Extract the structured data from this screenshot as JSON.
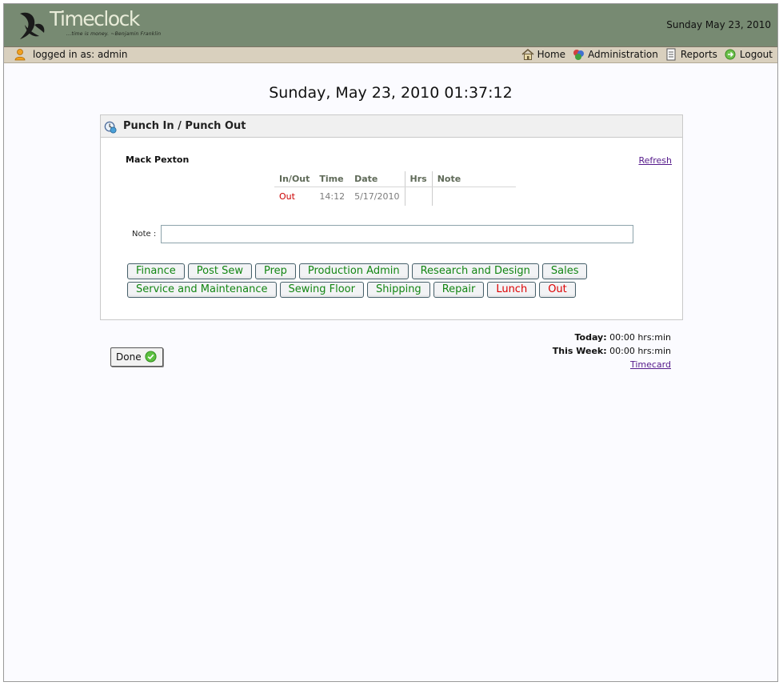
{
  "header": {
    "logo_text": "Timeclock",
    "tagline": "...time is money.   ~Benjamin Franklin",
    "date": "Sunday May 23, 2010"
  },
  "subbar": {
    "logged_in_label": "logged in as: admin",
    "nav": [
      {
        "label": "Home",
        "icon": "home-icon"
      },
      {
        "label": "Administration",
        "icon": "administration-icon"
      },
      {
        "label": "Reports",
        "icon": "reports-icon"
      },
      {
        "label": "Logout",
        "icon": "logout-icon"
      }
    ]
  },
  "clock": "Sunday, May 23, 2010 01:37:12",
  "panel": {
    "title": "Punch In / Punch Out",
    "employee": "Mack Pexton",
    "refresh": "Refresh",
    "table": {
      "headers": [
        "In/Out",
        "Time",
        "Date",
        "Hrs",
        "Note"
      ],
      "row": [
        "Out",
        "14:12",
        "5/17/2010",
        "",
        ""
      ]
    },
    "note_label": "Note :",
    "note_value": "",
    "buttons_row1": [
      "Finance",
      "Post Sew",
      "Prep",
      "Production Admin",
      "Research and Design",
      "Sales"
    ],
    "buttons_row2": [
      "Service and Maintenance",
      "Sewing Floor",
      "Shipping",
      "Repair",
      "Lunch",
      "Out"
    ]
  },
  "totals": {
    "today_label": "Today:",
    "today_value": "00:00 hrs:min",
    "week_label": "This Week:",
    "week_value": "00:00 hrs:min",
    "timecard": "Timecard"
  },
  "done_label": "Done",
  "colors": {
    "header_bg": "#778a72",
    "subbar_bg": "#d9d0be",
    "task_green": "#138613",
    "task_red": "#dd0000",
    "link": "#551a8b"
  }
}
